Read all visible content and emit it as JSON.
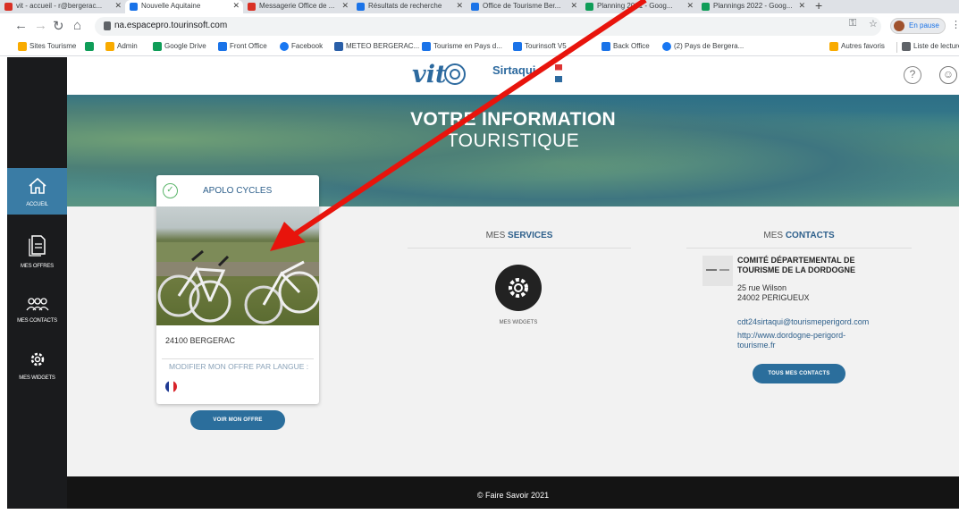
{
  "browser": {
    "tabs": [
      {
        "label": "vit - accueil - r@bergerac...",
        "color": "#d93025"
      },
      {
        "label": "Nouvelle Aquitaine",
        "color": "#1a73e8",
        "active": true
      },
      {
        "label": "Messagerie Office de ...",
        "color": "#d93025"
      },
      {
        "label": "Résultats de recherche",
        "color": "#1a73e8"
      },
      {
        "label": "Office de Tourisme Ber...",
        "color": "#1a73e8"
      },
      {
        "label": "Planning 2021 - Goog...",
        "color": "#0f9d58"
      },
      {
        "label": "Plannings 2022 - Goog...",
        "color": "#0f9d58"
      }
    ],
    "new_tab": "+",
    "url": "na.espacepro.tourinsoft.com",
    "profile_status": "En pause",
    "bookmarks": [
      {
        "label": "Sites Tourisme",
        "color": "#f9ab00"
      },
      {
        "label": "",
        "color": "#0f9d58"
      },
      {
        "label": "Admin",
        "color": "#f9ab00"
      },
      {
        "label": "Google Drive",
        "color": "#0f9d58"
      },
      {
        "label": "Front Office",
        "color": "#1a73e8"
      },
      {
        "label": "Facebook",
        "color": "#1877f2"
      },
      {
        "label": "METEO BERGERAC...",
        "color": "#2a5fa8"
      },
      {
        "label": "Tourisme en Pays d...",
        "color": "#1a73e8"
      },
      {
        "label": "Tourinsoft V5 ...",
        "color": "#1a73e8"
      },
      {
        "label": "Back Office",
        "color": "#1a73e8"
      },
      {
        "label": "(2) Pays de Bergera...",
        "color": "#1877f2"
      }
    ],
    "bookmarks_right": [
      {
        "label": "Autres favoris",
        "color": "#f9ab00"
      },
      {
        "label": "Liste de lecture",
        "color": "#5f6368"
      }
    ]
  },
  "sidebar": {
    "items": [
      {
        "label": "ACCUEIL",
        "icon": "home-icon",
        "active": true
      },
      {
        "label": "MES OFFRES",
        "icon": "document-icon"
      },
      {
        "label": "MES CONTACTS",
        "icon": "people-icon"
      },
      {
        "label": "MES WIDGETS",
        "icon": "gear-icon"
      }
    ]
  },
  "header": {
    "logo_vit": "vit",
    "logo_sirt": "Sirtaqui"
  },
  "hero": {
    "line1": "VOTRE INFORMATION",
    "line2": "TOURISTIQUE"
  },
  "offer": {
    "title": "APOLO CYCLES",
    "city": "24100 BERGERAC",
    "modify_label": "MODIFIER MON OFFRE PAR LANGUE :",
    "view_button": "VOIR MON OFFRE"
  },
  "services": {
    "heading_pre": "MES ",
    "heading_bold": "SERVICES",
    "widget_label": "MES WIDGETS"
  },
  "contacts": {
    "heading_pre": "MES ",
    "heading_bold": "CONTACTS",
    "name_line1": "COMITÉ DÉPARTEMENTAL DE",
    "name_line2": "TOURISME DE LA DORDOGNE",
    "address_line1": "25 rue Wilson",
    "address_line2": "24002 PERIGUEUX",
    "email": "cdt24sirtaqui@tourismeperigord.com",
    "website_line1": "http://www.dordogne-perigord-",
    "website_line2": "tourisme.fr",
    "all_contacts_button": "TOUS MES CONTACTS"
  },
  "footer": {
    "text": "© Faire Savoir 2021"
  },
  "colors": {
    "accent": "#2b6e9c",
    "sidebar": "#1a1b1d",
    "annotation_arrow": "#e8140c"
  }
}
